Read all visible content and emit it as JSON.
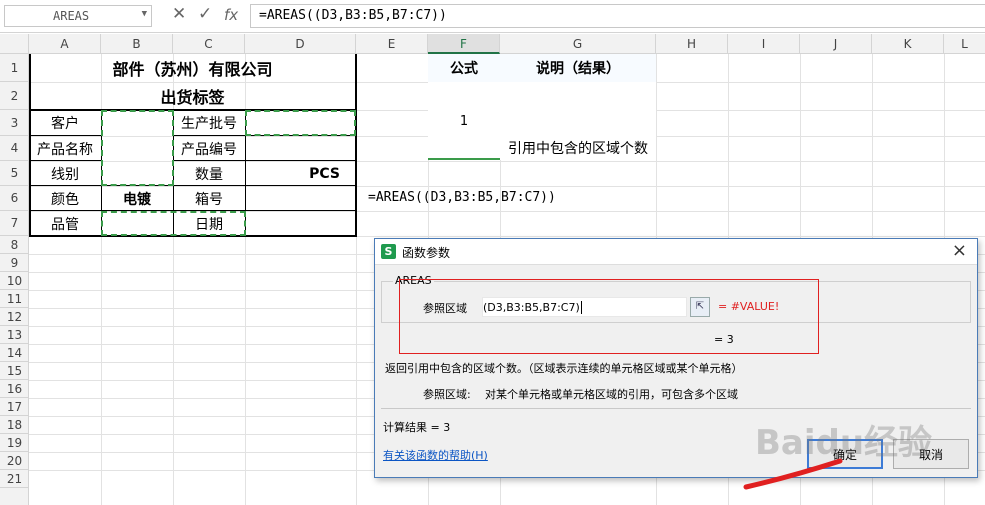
{
  "formula_bar": {
    "name_box": "AREAS",
    "cancel_icon": "✕",
    "confirm_icon": "✓",
    "fx_label": "fx",
    "formula": "=AREAS((D3,B3:B5,B7:C7))"
  },
  "columns": [
    "A",
    "B",
    "C",
    "D",
    "E",
    "F",
    "G",
    "H",
    "I",
    "J",
    "K",
    "L"
  ],
  "rows": [
    "1",
    "2",
    "3",
    "4",
    "5",
    "6",
    "7",
    "8",
    "9",
    "10",
    "11",
    "12",
    "13",
    "14",
    "15",
    "16",
    "17",
    "18",
    "19",
    "20",
    "21"
  ],
  "sheet": {
    "title": "部件（苏州）有限公司",
    "subtitle": "出货标签",
    "label_customer": "客户",
    "label_product_name": "产品名称",
    "label_wire": "线别",
    "label_color": "颜色",
    "value_color": "电镀",
    "label_qc": "品管",
    "label_batch": "生产批号",
    "label_product_no": "产品编号",
    "label_qty": "数量",
    "value_qty_unit": "PCS",
    "label_box": "箱号",
    "label_date": "日期",
    "formula_header": "公式",
    "desc_header": "说明（结果）",
    "result_value": "1",
    "desc_text": "引用中包含的区域个数",
    "formula_text": "=AREAS((D3,B3:B5,B7:C7))"
  },
  "dialog": {
    "title": "函数参数",
    "func_name": "AREAS",
    "param_label": "参照区域",
    "param_value": "(D3,B3:B5,B7:C7)",
    "param_eval": "=  #VALUE!",
    "result_preview": "=  3",
    "description": "返回引用中包含的区域个数。（区域表示连续的单元格区域或某个单元格）",
    "param_desc_label": "参照区域:",
    "param_desc": "对某个单元格或单元格区域的引用，可包含多个区域",
    "calc_result": "计算结果  =  3",
    "help_link": "有关该函数的帮助(H)",
    "ok_label": "确定",
    "cancel_label": "取消"
  },
  "watermark": "Baidu经验"
}
